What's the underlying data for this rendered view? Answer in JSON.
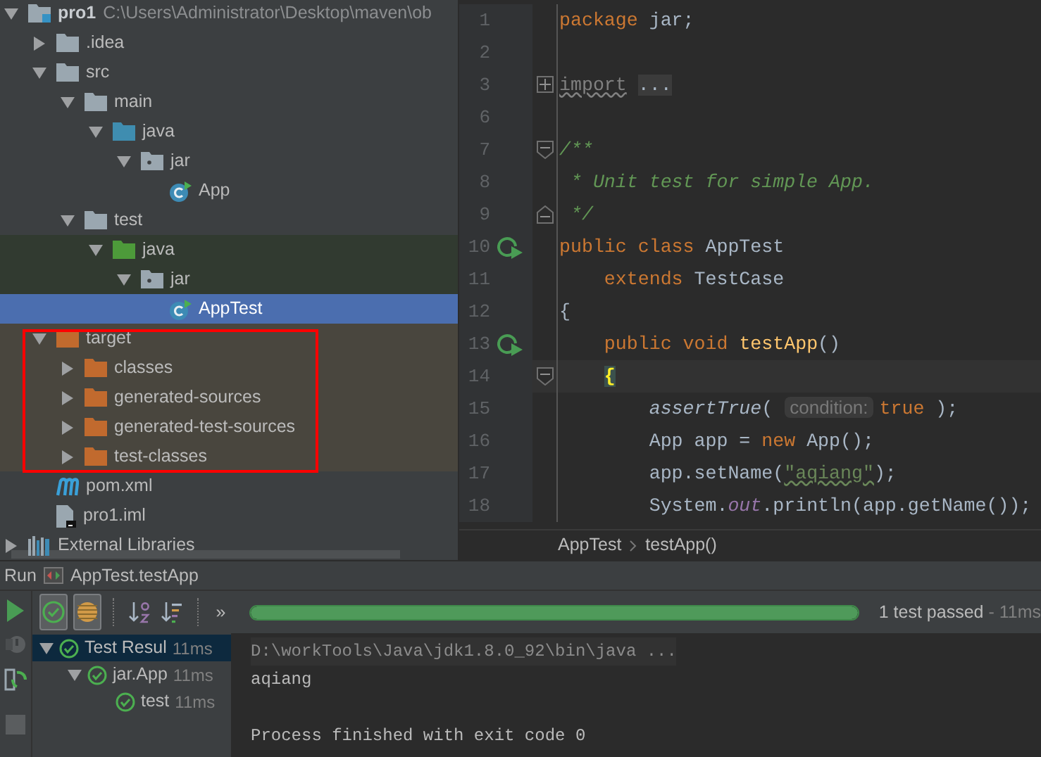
{
  "project_tree": [
    {
      "label": "pro1",
      "path": "C:\\Users\\Administrator\\Desktop\\maven\\ob",
      "kind": "module",
      "expanded": true,
      "selected": false,
      "children": [
        {
          "label": ".idea",
          "kind": "folder",
          "expanded": false,
          "selected": false
        },
        {
          "label": "src",
          "kind": "folder",
          "expanded": true,
          "selected": false,
          "children": [
            {
              "label": "main",
              "kind": "folder",
              "expanded": true,
              "selected": false,
              "children": [
                {
                  "label": "java",
                  "kind": "source-folder",
                  "expanded": true,
                  "selected": false,
                  "children": [
                    {
                      "label": "jar",
                      "kind": "package",
                      "expanded": true,
                      "selected": false,
                      "children": [
                        {
                          "label": "App",
                          "kind": "class",
                          "selected": false
                        }
                      ]
                    }
                  ]
                }
              ]
            },
            {
              "label": "test",
              "kind": "folder",
              "expanded": true,
              "selected": false,
              "children": [
                {
                  "label": "java",
                  "kind": "test-folder",
                  "expanded": true,
                  "selected": false,
                  "children": [
                    {
                      "label": "jar",
                      "kind": "package",
                      "expanded": true,
                      "selected": false,
                      "children": [
                        {
                          "label": "AppTest",
                          "kind": "class",
                          "selected": true
                        }
                      ]
                    }
                  ]
                }
              ]
            }
          ]
        },
        {
          "label": "target",
          "kind": "excluded-folder",
          "expanded": true,
          "selected": false,
          "outlined": true,
          "children": [
            {
              "label": "classes",
              "kind": "excluded-folder",
              "expanded": false,
              "selected": false
            },
            {
              "label": "generated-sources",
              "kind": "excluded-folder",
              "expanded": false,
              "selected": false
            },
            {
              "label": "generated-test-sources",
              "kind": "excluded-folder",
              "expanded": false,
              "selected": false
            },
            {
              "label": "test-classes",
              "kind": "excluded-folder",
              "expanded": false,
              "selected": false
            }
          ]
        },
        {
          "label": "pom.xml",
          "kind": "maven",
          "selected": false
        },
        {
          "label": "pro1.iml",
          "kind": "iml",
          "selected": false
        }
      ]
    },
    {
      "label": "External Libraries",
      "kind": "libraries",
      "expanded": false,
      "selected": false
    }
  ],
  "editor": {
    "lines": [
      {
        "number": "1",
        "run_marker": false,
        "tokens": [
          {
            "kind": "keyword",
            "text": "package"
          },
          {
            "kind": "plain",
            "text": " jar;"
          }
        ]
      },
      {
        "number": "2",
        "run_marker": false
      },
      {
        "number": "3",
        "run_marker": false,
        "fold": {
          "kind": "expand"
        },
        "tokens": [
          {
            "kind": "unused",
            "text": "import"
          },
          {
            "kind": "folded",
            "text": " ..."
          }
        ]
      },
      {
        "number": "6",
        "run_marker": false
      },
      {
        "number": "7",
        "run_marker": false,
        "fold": {
          "kind": "start"
        },
        "tokens": [
          {
            "kind": "comment",
            "text": "/**"
          }
        ]
      },
      {
        "number": "8",
        "run_marker": false,
        "tokens": [
          {
            "kind": "comment",
            "text": " * Unit test for simple App."
          }
        ]
      },
      {
        "number": "9",
        "run_marker": false,
        "fold": {
          "kind": "end"
        },
        "tokens": [
          {
            "kind": "comment",
            "text": " */"
          }
        ]
      },
      {
        "number": "10",
        "run_marker": true,
        "tokens": [
          {
            "kind": "keyword",
            "text": "public class "
          },
          {
            "kind": "plain",
            "text": "AppTest"
          }
        ]
      },
      {
        "number": "11",
        "run_marker": false,
        "tokens": [
          {
            "kind": "keyword",
            "text": "    extends "
          },
          {
            "kind": "plain",
            "text": "TestCase"
          }
        ]
      },
      {
        "number": "12",
        "run_marker": false,
        "tokens": [
          {
            "kind": "plain",
            "text": "{"
          }
        ]
      },
      {
        "number": "13",
        "run_marker": true,
        "tokens": [
          {
            "kind": "keyword",
            "text": "    public void "
          },
          {
            "kind": "method",
            "text": "testApp"
          },
          {
            "kind": "plain",
            "text": "()"
          }
        ]
      },
      {
        "number": "14",
        "run_marker": false,
        "fold": {
          "kind": "start"
        },
        "current": true,
        "tokens": [
          {
            "kind": "brace-match",
            "text": "    {"
          }
        ]
      },
      {
        "number": "15",
        "run_marker": false,
        "tokens": [
          {
            "kind": "static-call",
            "text": "        assertTrue"
          },
          {
            "kind": "plain",
            "text": "( "
          },
          {
            "kind": "hint",
            "text": "condition:"
          },
          {
            "kind": "keyword",
            "text": "true"
          },
          {
            "kind": "plain",
            "text": " );"
          }
        ]
      },
      {
        "number": "16",
        "run_marker": false,
        "tokens": [
          {
            "kind": "plain",
            "text": "        App app = "
          },
          {
            "kind": "keyword",
            "text": "new"
          },
          {
            "kind": "plain",
            "text": " App();"
          }
        ]
      },
      {
        "number": "17",
        "run_marker": false,
        "tokens": [
          {
            "kind": "plain",
            "text": "        app.setName("
          },
          {
            "kind": "string",
            "text": "\"aqiang\""
          },
          {
            "kind": "plain",
            "text": ");"
          }
        ]
      },
      {
        "number": "18",
        "run_marker": false,
        "tokens": [
          {
            "kind": "plain",
            "text": "        System."
          },
          {
            "kind": "static-field",
            "text": "out"
          },
          {
            "kind": "plain",
            "text": ".println(app.getName());"
          }
        ]
      }
    ],
    "breadcrumbs": [
      "AppTest",
      "testApp()"
    ]
  },
  "run_panel": {
    "title": "Run",
    "config": "AppTest.testApp",
    "toolbar": [
      {
        "kind": "show-passed",
        "on": true
      },
      {
        "kind": "show-ignored",
        "on": true
      },
      {
        "kind": "sort-alpha",
        "on": false
      },
      {
        "kind": "sort-duration",
        "on": false
      },
      {
        "kind": "more",
        "on": false
      }
    ],
    "more": "»",
    "progress": {
      "level": 1,
      "status": "1 test passed",
      "duration": " - 11ms"
    },
    "results": [
      {
        "label": "Test Resul",
        "time": "11ms",
        "expanded": true,
        "selected": true,
        "children": [
          {
            "label": "jar.App",
            "time": "11ms",
            "expanded": true,
            "selected": false,
            "children": [
              {
                "label": "test",
                "time": "11ms",
                "selected": false
              }
            ]
          }
        ]
      }
    ],
    "console": [
      {
        "kind": "command",
        "text": "D:\\workTools\\Java\\jdk1.8.0_92\\bin\\java ..."
      },
      {
        "kind": "output",
        "text": "aqiang"
      },
      {
        "kind": "blank"
      },
      {
        "kind": "output",
        "text": "Process finished with exit code 0"
      }
    ]
  }
}
